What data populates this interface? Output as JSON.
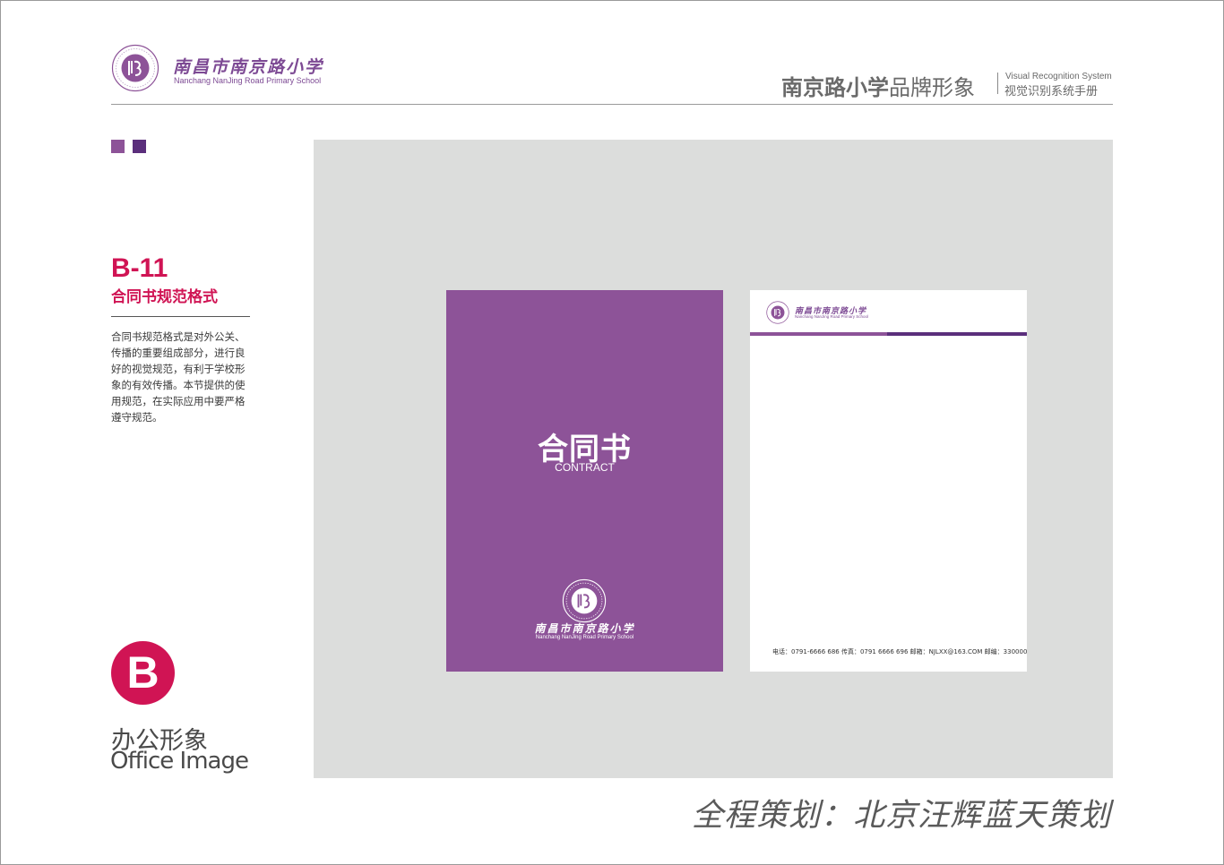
{
  "header": {
    "logo_cn": "南昌市南京路小学",
    "logo_en": "Nanchang NanJing Road Primary School",
    "title_bold": "南京路小学",
    "title_rest": "品牌形象",
    "vis_en": "Visual Recognition System",
    "vis_cn": "视觉识别系统手册"
  },
  "section": {
    "code": "B-11",
    "title": "合同书规范格式",
    "description": "合同书规范格式是对外公关、传播的重要组成部分，进行良好的视觉规范，有利于学校形象的有效传播。本节提供的使用规范，在实际应用中要严格遵守规范。"
  },
  "category": {
    "badge": "B",
    "name_cn": "办公形象",
    "name_en": "Office Image"
  },
  "cover": {
    "title": "合同书",
    "subtitle": "CONTRACT",
    "logo_cn": "南昌市南京路小学",
    "logo_en": "Nanchang NanJing Road Primary School"
  },
  "letterhead": {
    "logo_cn": "南昌市南京路小学",
    "logo_en": "Nanchang NanJing Road Primary School",
    "footer": "电话：0791-6666 686  传真：0791 6666 696  邮箱：NJLXX@163.COM  邮编：330000"
  },
  "credit": "全程策划：北京汪辉蓝天策划",
  "colors": {
    "brand_purple": "#8d5398",
    "dark_purple": "#5b2f7c",
    "accent_red": "#d01454",
    "canvas_gray": "#dcdddc"
  },
  "icons": [
    "school-seal-icon"
  ]
}
